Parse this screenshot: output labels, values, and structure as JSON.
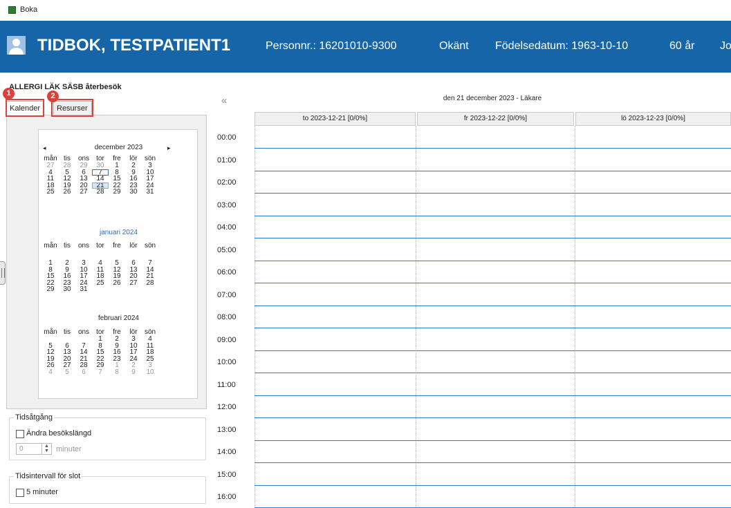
{
  "window": {
    "title": "Boka",
    "icon": "app-icon"
  },
  "header": {
    "title": "TIDBOK, TESTPATIENT1",
    "personnr": "Personnr.: 16201010-9300",
    "gender": "Okänt",
    "birthdate": "Födelsedatum: 1963-10-10",
    "age": "60 år",
    "cutoff": "Jo",
    "background_color": "#1565a8"
  },
  "subtitle": "ALLERGI LÄK SÄSB återbesök",
  "tabs": [
    {
      "label": "Kalender",
      "active": true
    },
    {
      "label": "Resurser",
      "active": false
    }
  ],
  "annotations": [
    {
      "number": "1",
      "color": "#d9413a"
    },
    {
      "number": "2",
      "color": "#d9413a"
    }
  ],
  "calendar": {
    "weekdays": [
      "mån",
      "tis",
      "ons",
      "tor",
      "fre",
      "lör",
      "sön"
    ],
    "months": [
      {
        "name": "december 2023",
        "weeks": [
          [
            "27",
            "28",
            "29",
            "30",
            "1",
            "2",
            "3"
          ],
          [
            "4",
            "5",
            "6",
            "7",
            "8",
            "9",
            "10"
          ],
          [
            "11",
            "12",
            "13",
            "14",
            "15",
            "16",
            "17"
          ],
          [
            "18",
            "19",
            "20",
            "21",
            "22",
            "23",
            "24"
          ],
          [
            "25",
            "26",
            "27",
            "28",
            "29",
            "30",
            "31"
          ]
        ]
      },
      {
        "name": "januari 2024",
        "weeks": [
          [
            "1",
            "2",
            "3",
            "4",
            "5",
            "6",
            "7"
          ],
          [
            "8",
            "9",
            "10",
            "11",
            "12",
            "13",
            "14"
          ],
          [
            "15",
            "16",
            "17",
            "18",
            "19",
            "20",
            "21"
          ],
          [
            "22",
            "23",
            "24",
            "25",
            "26",
            "27",
            "28"
          ],
          [
            "29",
            "30",
            "31",
            "",
            "",
            "",
            ""
          ]
        ]
      },
      {
        "name": "februari 2024",
        "weeks": [
          [
            "",
            "",
            "",
            "1",
            "2",
            "3",
            "4"
          ],
          [
            "5",
            "6",
            "7",
            "8",
            "9",
            "10",
            "11"
          ],
          [
            "12",
            "13",
            "14",
            "15",
            "16",
            "17",
            "18"
          ],
          [
            "19",
            "20",
            "21",
            "22",
            "23",
            "24",
            "25"
          ],
          [
            "26",
            "27",
            "28",
            "29",
            "1",
            "2",
            "3"
          ],
          [
            "4",
            "5",
            "6",
            "7",
            "8",
            "9",
            "10"
          ]
        ]
      }
    ],
    "prev": "◂",
    "next": "▸"
  },
  "tidsatgang": {
    "legend": "Tidsåtgång",
    "checkbox_label": "Ändra besökslängd",
    "spinner_value": "0",
    "unit": "minuter"
  },
  "tidsintervall": {
    "legend": "Tidsintervall för slot",
    "checkbox_label": "5 minuter"
  },
  "schedule": {
    "collapse_label": "«",
    "title": "den 21 december 2023 - Läkare",
    "days": [
      "to 2023-12-21  [0/0%]",
      "fr 2023-12-22  [0/0%]",
      "lö 2023-12-23  [0/0%]"
    ],
    "times": [
      "00:00",
      "01:00",
      "02:00",
      "03:00",
      "04:00",
      "05:00",
      "06:00",
      "07:00",
      "08:00",
      "09:00",
      "10:00",
      "11:00",
      "12:00",
      "13:00",
      "14:00",
      "15:00",
      "16:00"
    ],
    "line_color": "#2f7bd1"
  }
}
